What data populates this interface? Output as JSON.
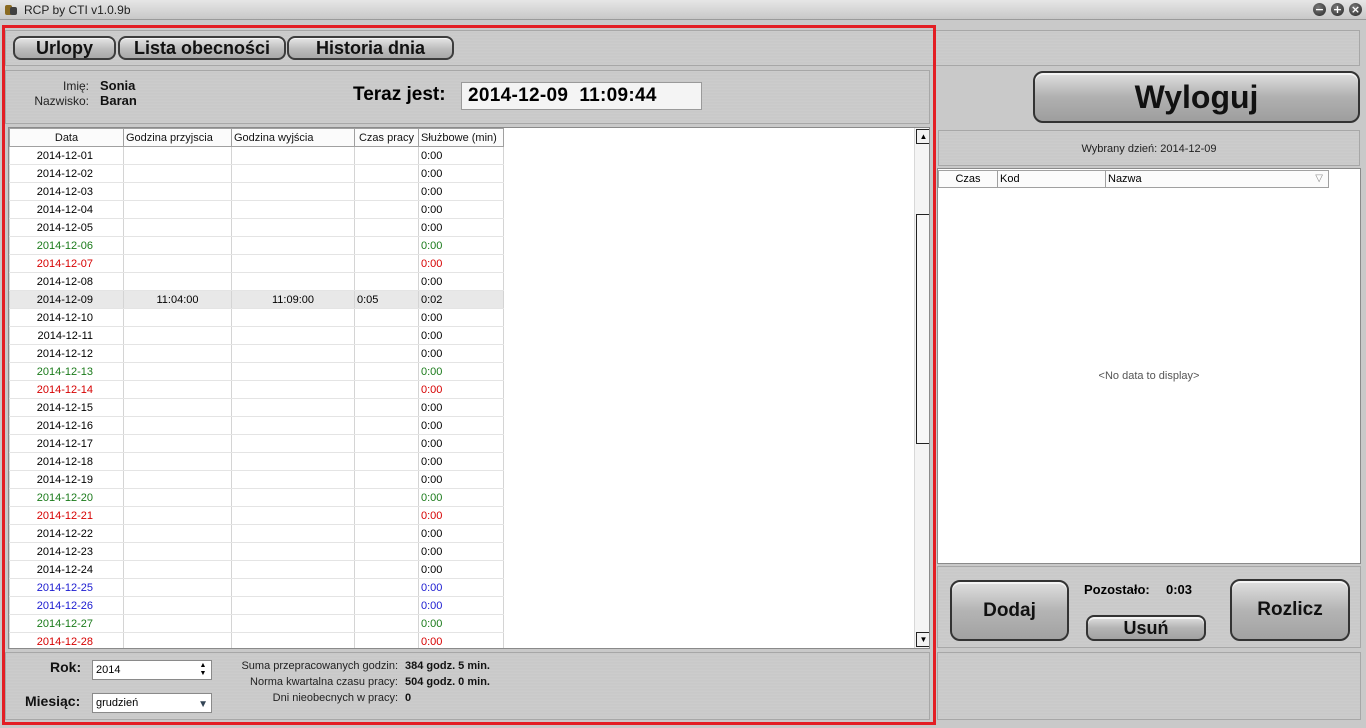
{
  "window": {
    "title": "RCP by CTI v1.0.9b"
  },
  "toolbar": {
    "tabs": [
      "Urlopy",
      "Lista obecności",
      "Historia dnia"
    ]
  },
  "user": {
    "first_name_label": "Imię:",
    "first_name": "Sonia",
    "last_name_label": "Nazwisko:",
    "last_name": "Baran"
  },
  "clock": {
    "label": "Teraz jest:",
    "value": "2014-12-09  11:09:44"
  },
  "grid": {
    "columns": [
      "Data",
      "Godzina przyjscia",
      "Godzina wyjścia",
      "Czas pracy",
      "Służbowe (min)"
    ],
    "rows": [
      {
        "date": "2014-12-01",
        "in": "",
        "out": "",
        "work": "",
        "service": "0:00",
        "color": "black"
      },
      {
        "date": "2014-12-02",
        "in": "",
        "out": "",
        "work": "",
        "service": "0:00",
        "color": "black"
      },
      {
        "date": "2014-12-03",
        "in": "",
        "out": "",
        "work": "",
        "service": "0:00",
        "color": "black"
      },
      {
        "date": "2014-12-04",
        "in": "",
        "out": "",
        "work": "",
        "service": "0:00",
        "color": "black"
      },
      {
        "date": "2014-12-05",
        "in": "",
        "out": "",
        "work": "",
        "service": "0:00",
        "color": "black"
      },
      {
        "date": "2014-12-06",
        "in": "",
        "out": "",
        "work": "",
        "service": "0:00",
        "color": "green"
      },
      {
        "date": "2014-12-07",
        "in": "",
        "out": "",
        "work": "",
        "service": "0:00",
        "color": "red"
      },
      {
        "date": "2014-12-08",
        "in": "",
        "out": "",
        "work": "",
        "service": "0:00",
        "color": "black"
      },
      {
        "date": "2014-12-09",
        "in": "11:04:00",
        "out": "11:09:00",
        "work": "0:05",
        "service": "0:02",
        "color": "black",
        "selected": true
      },
      {
        "date": "2014-12-10",
        "in": "",
        "out": "",
        "work": "",
        "service": "0:00",
        "color": "black"
      },
      {
        "date": "2014-12-11",
        "in": "",
        "out": "",
        "work": "",
        "service": "0:00",
        "color": "black"
      },
      {
        "date": "2014-12-12",
        "in": "",
        "out": "",
        "work": "",
        "service": "0:00",
        "color": "black"
      },
      {
        "date": "2014-12-13",
        "in": "",
        "out": "",
        "work": "",
        "service": "0:00",
        "color": "green"
      },
      {
        "date": "2014-12-14",
        "in": "",
        "out": "",
        "work": "",
        "service": "0:00",
        "color": "red"
      },
      {
        "date": "2014-12-15",
        "in": "",
        "out": "",
        "work": "",
        "service": "0:00",
        "color": "black"
      },
      {
        "date": "2014-12-16",
        "in": "",
        "out": "",
        "work": "",
        "service": "0:00",
        "color": "black"
      },
      {
        "date": "2014-12-17",
        "in": "",
        "out": "",
        "work": "",
        "service": "0:00",
        "color": "black"
      },
      {
        "date": "2014-12-18",
        "in": "",
        "out": "",
        "work": "",
        "service": "0:00",
        "color": "black"
      },
      {
        "date": "2014-12-19",
        "in": "",
        "out": "",
        "work": "",
        "service": "0:00",
        "color": "black"
      },
      {
        "date": "2014-12-20",
        "in": "",
        "out": "",
        "work": "",
        "service": "0:00",
        "color": "green"
      },
      {
        "date": "2014-12-21",
        "in": "",
        "out": "",
        "work": "",
        "service": "0:00",
        "color": "red"
      },
      {
        "date": "2014-12-22",
        "in": "",
        "out": "",
        "work": "",
        "service": "0:00",
        "color": "black"
      },
      {
        "date": "2014-12-23",
        "in": "",
        "out": "",
        "work": "",
        "service": "0:00",
        "color": "black"
      },
      {
        "date": "2014-12-24",
        "in": "",
        "out": "",
        "work": "",
        "service": "0:00",
        "color": "black"
      },
      {
        "date": "2014-12-25",
        "in": "",
        "out": "",
        "work": "",
        "service": "0:00",
        "color": "blue"
      },
      {
        "date": "2014-12-26",
        "in": "",
        "out": "",
        "work": "",
        "service": "0:00",
        "color": "blue"
      },
      {
        "date": "2014-12-27",
        "in": "",
        "out": "",
        "work": "",
        "service": "0:00",
        "color": "green"
      },
      {
        "date": "2014-12-28",
        "in": "",
        "out": "",
        "work": "",
        "service": "0:00",
        "color": "red"
      }
    ]
  },
  "filters": {
    "year_label": "Rok:",
    "year": "2014",
    "month_label": "Miesiąc:",
    "month": "grudzień"
  },
  "summary": [
    {
      "label": "Suma przepracowanych godzin:",
      "value": "384 godz. 5 min."
    },
    {
      "label": "Norma kwartalna czasu pracy:",
      "value": "504 godz. 0 min."
    },
    {
      "label": "Dni nieobecnych w pracy:",
      "value": "0"
    }
  ],
  "right": {
    "logout_label": "Wyloguj",
    "selected_day": "Wybrany dzień: 2014-12-09",
    "day_columns": [
      "Czas",
      "Kod",
      "Nazwa"
    ],
    "no_data": "<No data to display>",
    "remaining_label": "Pozostało:",
    "remaining_value": "0:03",
    "add_label": "Dodaj",
    "remove_label": "Usuń",
    "settle_label": "Rozlicz"
  },
  "colors": {
    "black": "#000000",
    "green": "#1a7a1a",
    "red": "#d60000",
    "blue": "#1a1ad0",
    "frame": "#e31e24"
  }
}
